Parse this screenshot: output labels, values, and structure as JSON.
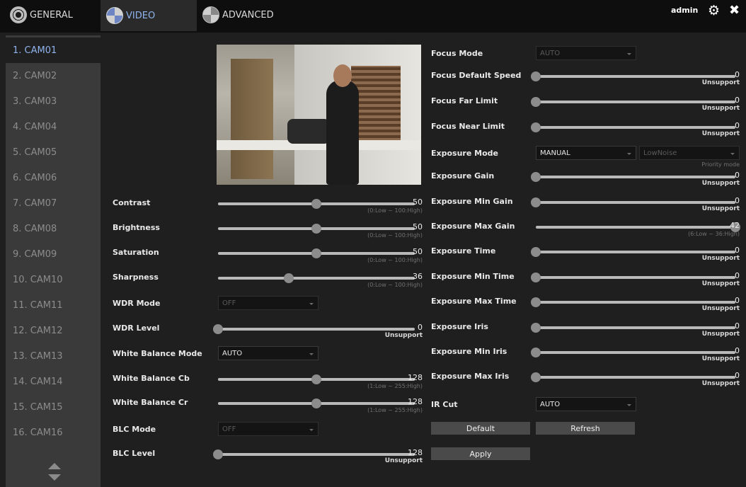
{
  "tabs": [
    {
      "label": "GENERAL"
    },
    {
      "label": "VIDEO"
    },
    {
      "label": "ADVANCED"
    }
  ],
  "user": {
    "name": "admin"
  },
  "icons": {
    "settings": "gear-icon",
    "close": "close-icon"
  },
  "colors": {
    "active_text": "#8fb4ee",
    "background": "#1f1f1f",
    "sidebar": "#3a3a3a"
  },
  "cameras": [
    "1. CAM01",
    "2. CAM02",
    "3. CAM03",
    "4. CAM04",
    "5. CAM05",
    "6. CAM06",
    "7. CAM07",
    "8. CAM08",
    "9. CAM09",
    "10. CAM10",
    "11. CAM11",
    "12. CAM12",
    "13. CAM13",
    "14. CAM14",
    "15. CAM15",
    "16. CAM16"
  ],
  "active_camera_index": 0,
  "left": {
    "contrast": {
      "label": "Contrast",
      "value": "50",
      "level": 0.5,
      "note": "(0:Low ~ 100:High)"
    },
    "brightness": {
      "label": "Brightness",
      "value": "50",
      "level": 0.5,
      "note": "(0:Low ~ 100:High)"
    },
    "saturation": {
      "label": "Saturation",
      "value": "50",
      "level": 0.5,
      "note": "(0:Low ~ 100:High)"
    },
    "sharpness": {
      "label": "Sharpness",
      "value": "36",
      "level": 0.36,
      "note": "(0:Low ~ 100:High)"
    },
    "wdr_mode": {
      "label": "WDR Mode",
      "value": "OFF"
    },
    "wdr_level": {
      "label": "WDR Level",
      "value": "0",
      "level": 0,
      "note": "Unsupport"
    },
    "wb_mode": {
      "label": "White Balance Mode",
      "value": "AUTO"
    },
    "wb_cb": {
      "label": "White Balance Cb",
      "value": "128",
      "level": 0.5,
      "note": "(1:Low ~ 255:High)"
    },
    "wb_cr": {
      "label": "White Balance Cr",
      "value": "128",
      "level": 0.5,
      "note": "(1:Low ~ 255:High)"
    },
    "blc_mode": {
      "label": "BLC Mode",
      "value": "OFF"
    },
    "blc_level": {
      "label": "BLC Level",
      "value": "128",
      "level": 0,
      "note": "Unsupport"
    }
  },
  "right": {
    "focus_mode": {
      "label": "Focus Mode",
      "value": "AUTO"
    },
    "focus_default_speed": {
      "label": "Focus Default Speed",
      "value": "0",
      "level": 0,
      "note": "Unsupport"
    },
    "focus_far_limit": {
      "label": "Focus Far Limit",
      "value": "0",
      "level": 0,
      "note": "Unsupport"
    },
    "focus_near_limit": {
      "label": "Focus Near Limit",
      "value": "0",
      "level": 0,
      "note": "Unsupport"
    },
    "exposure_mode": {
      "label": "Exposure Mode",
      "value": "MANUAL",
      "priority_value": "LowNoise",
      "priority_note": "Priority mode"
    },
    "exposure_gain": {
      "label": "Exposure Gain",
      "value": "0",
      "level": 0,
      "note": "Unsupport"
    },
    "exposure_min_gain": {
      "label": "Exposure Min Gain",
      "value": "0",
      "level": 0,
      "note": "Unsupport"
    },
    "exposure_max_gain": {
      "label": "Exposure Max Gain",
      "value": "42",
      "level": 1,
      "note": "(6:Low ~ 36:High)"
    },
    "exposure_time": {
      "label": "Exposure Time",
      "value": "0",
      "level": 0,
      "note": "Unsupport"
    },
    "exposure_min_time": {
      "label": "Exposure Min Time",
      "value": "0",
      "level": 0,
      "note": "Unsupport"
    },
    "exposure_max_time": {
      "label": "Exposure Max Time",
      "value": "0",
      "level": 0,
      "note": "Unsupport"
    },
    "exposure_iris": {
      "label": "Exposure Iris",
      "value": "0",
      "level": 0,
      "note": "Unsupport"
    },
    "exposure_min_iris": {
      "label": "Exposure Min Iris",
      "value": "0",
      "level": 0,
      "note": "Unsupport"
    },
    "exposure_max_iris": {
      "label": "Exposure Max Iris",
      "value": "0",
      "level": 0,
      "note": "Unsupport"
    },
    "ir_cut": {
      "label": "IR Cut",
      "value": "AUTO"
    }
  },
  "buttons": {
    "default": "Default",
    "refresh": "Refresh",
    "apply": "Apply"
  }
}
